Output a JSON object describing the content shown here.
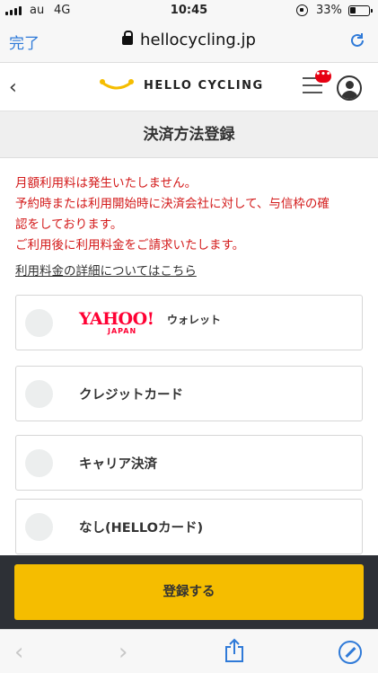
{
  "status_bar": {
    "carrier": "au",
    "network": "4G",
    "time": "10:45",
    "battery": "33%"
  },
  "browser": {
    "done_label": "完了",
    "url": "hellocycling.jp"
  },
  "site": {
    "logo_text": "HELLO CYCLING",
    "badge_text": "•••"
  },
  "page": {
    "title": "決済方法登録",
    "notice_lines": [
      "月額利用料は発生いたしません。",
      "予約時または利用開始時に決済会社に対して、与信枠の確",
      "認をしております。",
      "ご利用後に利用料金をご請求いたします。"
    ],
    "detail_link": "利用料金の詳細についてはこちら"
  },
  "options": {
    "yahoo": {
      "logo": "YAHOO!",
      "logo_sub": "JAPAN",
      "label": "ウォレット"
    },
    "credit": {
      "label": "クレジットカード"
    },
    "carrier": {
      "label": "キャリア決済"
    },
    "none": {
      "label": "なし(HELLOカード)"
    }
  },
  "footer": {
    "register_label": "登録する"
  },
  "toolbar": {
    "back_glyph": "‹",
    "forward_glyph": "›"
  },
  "colors": {
    "accent": "#f5bd00",
    "notice": "#d31a1a",
    "ios_blue": "#2f7ad8"
  }
}
